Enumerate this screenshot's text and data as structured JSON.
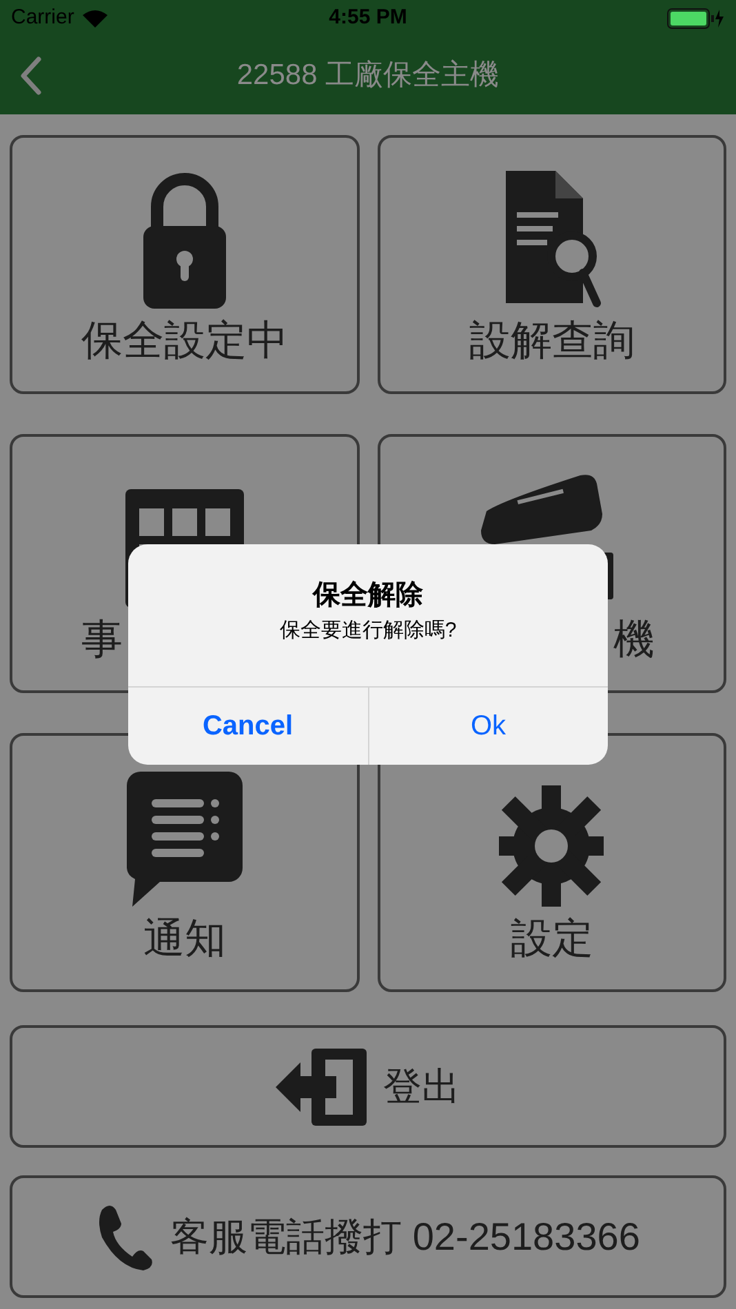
{
  "status_bar": {
    "carrier": "Carrier",
    "time": "4:55 PM"
  },
  "nav_bar": {
    "title": "22588 工廠保全主機"
  },
  "tiles": [
    {
      "kind": "lock",
      "label": "保全設定中"
    },
    {
      "kind": "document",
      "label": "設解查詢"
    },
    {
      "kind": "keypad",
      "label": "事"
    },
    {
      "kind": "camera",
      "label": "機"
    },
    {
      "kind": "chat",
      "label": "通知"
    },
    {
      "kind": "gear",
      "label": "設定"
    }
  ],
  "logout_button": {
    "label": "登出"
  },
  "call_button": {
    "label": "客服電話撥打 02-25183366"
  },
  "alert": {
    "title": "保全解除",
    "message": "保全要進行解除嗎?",
    "buttons": [
      {
        "label": "Cancel",
        "kind": "cancel"
      },
      {
        "label": "Ok",
        "kind": "default"
      }
    ]
  }
}
